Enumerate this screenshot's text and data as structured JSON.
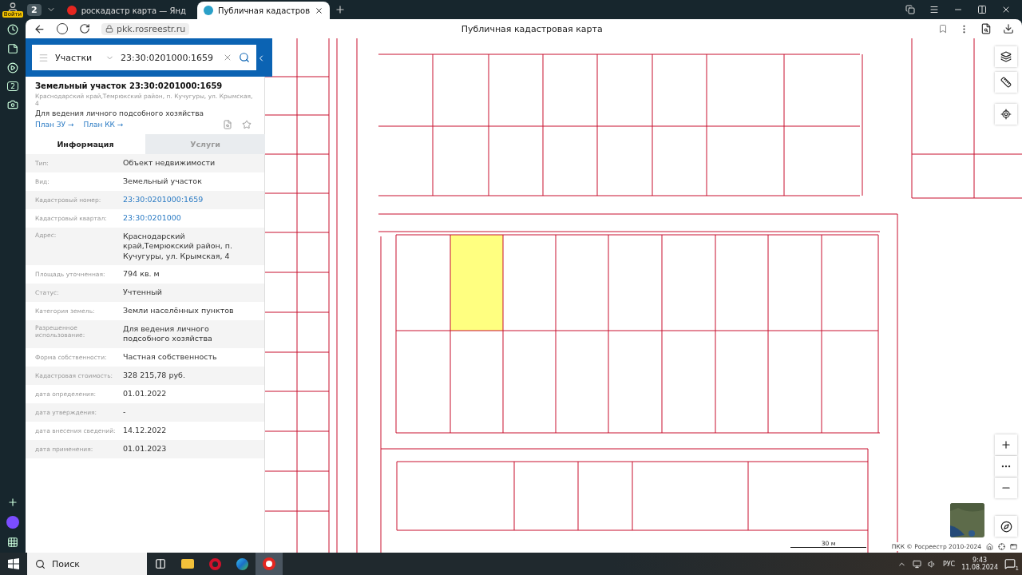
{
  "browser": {
    "profile_label": "Войти",
    "tab_count": "2",
    "url": "pkk.rosreestr.ru",
    "page_title": "Публичная кадастровая карта",
    "tabs": [
      {
        "title": "роскадастр карта — Янд",
        "selected": false
      },
      {
        "title": "Публичная кадастров",
        "selected": true
      }
    ],
    "sidebar_badge": "2"
  },
  "search": {
    "category": "Участки",
    "query": "23:30:0201000:1659"
  },
  "parcel": {
    "title": "Земельный участок 23:30:0201000:1659",
    "address": "Краснодарский край,Темрюкский район, п. Кучугуры, ул. Крымская, 4",
    "usage": "Для ведения личного подсобного хозяйства",
    "links": [
      "План ЗУ →",
      "План КК →"
    ]
  },
  "panel_tabs": [
    {
      "label": "Информация",
      "selected": true
    },
    {
      "label": "Услуги",
      "selected": false
    }
  ],
  "fields": [
    {
      "label": "Тип:",
      "value": "Объект недвижимости",
      "kind": "text"
    },
    {
      "label": "Вид:",
      "value": "Земельный участок",
      "kind": "text"
    },
    {
      "label": "Кадастровый номер:",
      "value": "23:30:0201000:1659",
      "kind": "link"
    },
    {
      "label": "Кадастровый квартал:",
      "value": "23:30:0201000",
      "kind": "link"
    },
    {
      "label": "Адрес:",
      "value": "Краснодарский край,Темрюкский район, п. Кучугуры, ул. Крымская, 4",
      "kind": "text"
    },
    {
      "label": "Площадь уточненная:",
      "value": "794 кв. м",
      "kind": "text"
    },
    {
      "label": "Статус:",
      "value": "Учтенный",
      "kind": "text"
    },
    {
      "label": "Категория земель:",
      "value": "Земли населённых пунктов",
      "kind": "text"
    },
    {
      "label": "Разрешенное использование:",
      "value": "Для ведения личного подсобного хозяйства",
      "kind": "text"
    },
    {
      "label": "Форма собственности:",
      "value": "Частная собственность",
      "kind": "text"
    },
    {
      "label": "Кадастровая стоимость:",
      "value": "328 215,78 руб.",
      "kind": "text"
    },
    {
      "label": "дата определения:",
      "value": "01.01.2022",
      "kind": "text"
    },
    {
      "label": "дата утверждения:",
      "value": "-",
      "kind": "text"
    },
    {
      "label": "дата внесения сведений:",
      "value": "14.12.2022",
      "kind": "text"
    },
    {
      "label": "дата применения:",
      "value": "01.01.2023",
      "kind": "text"
    }
  ],
  "map": {
    "kind": "picture",
    "scale": "30 м",
    "attribution": "ПКК © Росреестр 2010-2024"
  },
  "taskbar": {
    "search_placeholder": "Поиск",
    "language": "РУС",
    "time": "9:43",
    "date": "11.08.2024",
    "notifications": "1"
  }
}
